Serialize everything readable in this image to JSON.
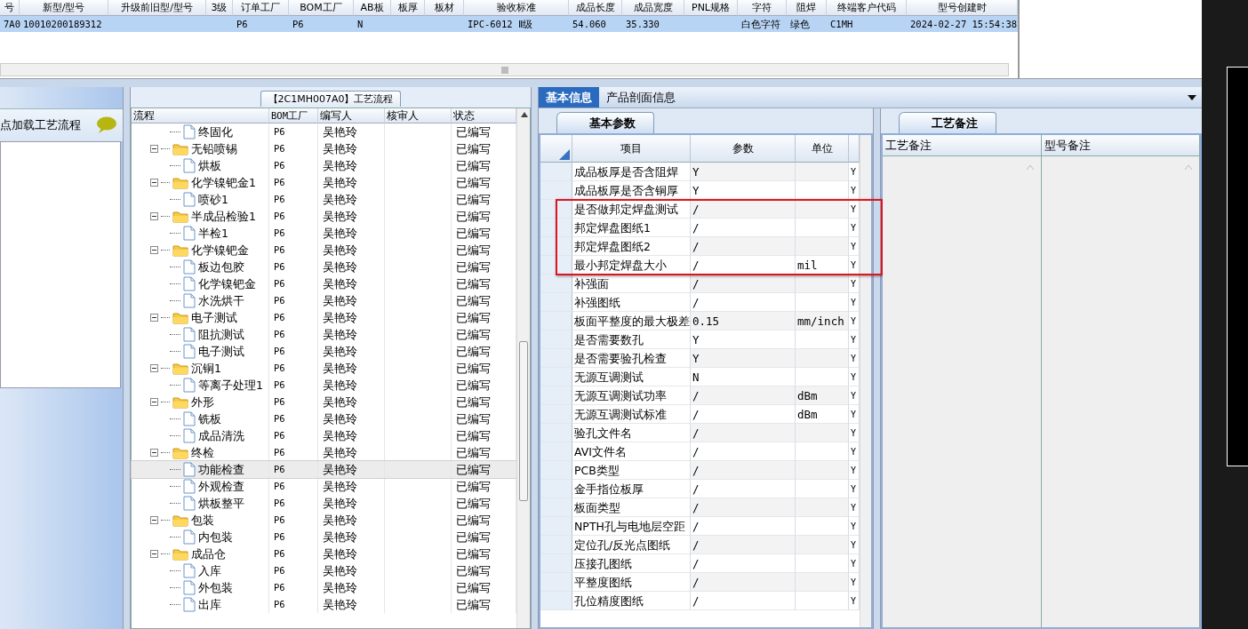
{
  "order_table": {
    "columns": [
      "号",
      "新型/型号",
      "升级前旧型/型号",
      "3级",
      "订单工厂",
      "BOM工厂",
      "AB板",
      "板厚",
      "板材",
      "验收标准",
      "成品长度",
      "成品宽度",
      "PNL规格",
      "字符",
      "阻焊",
      "终端客户代码",
      "型号创建时"
    ],
    "rows": [
      {
        "selected": true,
        "cells": [
          "7A0",
          "10010200189312",
          null,
          null,
          "P6",
          "P6",
          "N",
          null,
          null,
          "IPC-6012 Ⅱ级",
          "54.060",
          "35.330",
          null,
          "白色字符",
          "绿色",
          "C1MH",
          "2024-02-27 15:54:38"
        ]
      }
    ]
  },
  "left_panel": {
    "hint": "点加载工艺流程"
  },
  "process_tree": {
    "title": "【2C1MH007A0】工艺流程",
    "columns": [
      "流程",
      "BOM工厂",
      "编写人",
      "核审人",
      "状态"
    ],
    "items": [
      {
        "label": "终固化",
        "kind": "file",
        "selected": false,
        "bom": "P6",
        "author": "吴艳玲",
        "status": "已编写"
      },
      {
        "label": "无铅喷锡",
        "kind": "folder",
        "expanded": true,
        "selected": false,
        "bom": "P6",
        "author": "吴艳玲",
        "status": "已编写",
        "children": [
          {
            "label": "烘板",
            "kind": "file",
            "selected": false,
            "bom": "P6",
            "author": "吴艳玲",
            "status": "已编写"
          }
        ]
      },
      {
        "label": "化学镍钯金1",
        "kind": "folder",
        "expanded": true,
        "selected": false,
        "bom": "P6",
        "author": "吴艳玲",
        "status": "已编写",
        "children": [
          {
            "label": "喷砂1",
            "kind": "file",
            "selected": false,
            "bom": "P6",
            "author": "吴艳玲",
            "status": "已编写"
          }
        ]
      },
      {
        "label": "半成品检验1",
        "kind": "folder",
        "expanded": true,
        "selected": false,
        "bom": "P6",
        "author": "吴艳玲",
        "status": "已编写",
        "children": [
          {
            "label": "半检1",
            "kind": "file",
            "selected": false,
            "bom": "P6",
            "author": "吴艳玲",
            "status": "已编写"
          }
        ]
      },
      {
        "label": "化学镍钯金",
        "kind": "folder",
        "expanded": true,
        "selected": false,
        "bom": "P6",
        "author": "吴艳玲",
        "status": "已编写",
        "children": [
          {
            "label": "板边包胶",
            "kind": "file",
            "selected": false,
            "bom": "P6",
            "author": "吴艳玲",
            "status": "已编写"
          },
          {
            "label": "化学镍钯金",
            "kind": "file",
            "selected": false,
            "bom": "P6",
            "author": "吴艳玲",
            "status": "已编写"
          },
          {
            "label": "水洗烘干",
            "kind": "file",
            "selected": false,
            "bom": "P6",
            "author": "吴艳玲",
            "status": "已编写"
          }
        ]
      },
      {
        "label": "电子测试",
        "kind": "folder",
        "expanded": true,
        "selected": false,
        "bom": "P6",
        "author": "吴艳玲",
        "status": "已编写",
        "children": [
          {
            "label": "阻抗测试",
            "kind": "file",
            "selected": false,
            "bom": "P6",
            "author": "吴艳玲",
            "status": "已编写"
          },
          {
            "label": "电子测试",
            "kind": "file",
            "selected": false,
            "bom": "P6",
            "author": "吴艳玲",
            "status": "已编写"
          }
        ]
      },
      {
        "label": "沉铜1",
        "kind": "folder",
        "expanded": true,
        "selected": false,
        "bom": "P6",
        "author": "吴艳玲",
        "status": "已编写",
        "children": [
          {
            "label": "等离子处理1",
            "kind": "file",
            "selected": false,
            "bom": "P6",
            "author": "吴艳玲",
            "status": "已编写"
          }
        ]
      },
      {
        "label": "外形",
        "kind": "folder",
        "expanded": true,
        "selected": false,
        "bom": "P6",
        "author": "吴艳玲",
        "status": "已编写",
        "children": [
          {
            "label": "铣板",
            "kind": "file",
            "selected": false,
            "bom": "P6",
            "author": "吴艳玲",
            "status": "已编写"
          },
          {
            "label": "成品清洗",
            "kind": "file",
            "selected": false,
            "bom": "P6",
            "author": "吴艳玲",
            "status": "已编写"
          }
        ]
      },
      {
        "label": "终检",
        "kind": "folder",
        "expanded": true,
        "selected": false,
        "bom": "P6",
        "author": "吴艳玲",
        "status": "已编写",
        "children": [
          {
            "label": "功能检查",
            "kind": "file",
            "selected": true,
            "bom": "P6",
            "author": "吴艳玲",
            "status": "已编写"
          },
          {
            "label": "外观检查",
            "kind": "file",
            "selected": false,
            "bom": "P6",
            "author": "吴艳玲",
            "status": "已编写"
          },
          {
            "label": "烘板整平",
            "kind": "file",
            "selected": false,
            "bom": "P6",
            "author": "吴艳玲",
            "status": "已编写"
          }
        ]
      },
      {
        "label": "包装",
        "kind": "folder",
        "expanded": true,
        "selected": false,
        "bom": "P6",
        "author": "吴艳玲",
        "status": "已编写",
        "children": [
          {
            "label": "内包装",
            "kind": "file",
            "selected": false,
            "bom": "P6",
            "author": "吴艳玲",
            "status": "已编写"
          }
        ]
      },
      {
        "label": "成品仓",
        "kind": "folder",
        "expanded": true,
        "selected": false,
        "bom": "P6",
        "author": "吴艳玲",
        "status": "已编写",
        "children": [
          {
            "label": "入库",
            "kind": "file",
            "selected": false,
            "bom": "P6",
            "author": "吴艳玲",
            "status": "已编写"
          },
          {
            "label": "外包装",
            "kind": "file",
            "selected": false,
            "bom": "P6",
            "author": "吴艳玲",
            "status": "已编写"
          },
          {
            "label": "出库",
            "kind": "file",
            "selected": false,
            "bom": "P6",
            "author": "吴艳玲",
            "status": "已编写"
          }
        ]
      }
    ]
  },
  "info_tabs": [
    {
      "label": "基本信息",
      "selected": true
    },
    {
      "label": "产品剖面信息",
      "selected": false
    }
  ],
  "params": {
    "tab": {
      "label": "基本参数",
      "selected": true
    },
    "columns": [
      "项目",
      "参数",
      "单位"
    ],
    "rows": [
      {
        "item": "成品板厚是否含阻焊",
        "value": "Y",
        "flag": "Y",
        "highlighted": false
      },
      {
        "item": "成品板厚是否含铜厚",
        "value": "Y",
        "flag": "Y",
        "highlighted": false
      },
      {
        "item": "是否做邦定焊盘测试",
        "value": "/",
        "flag": "Y",
        "highlighted": true
      },
      {
        "item": "邦定焊盘图纸1",
        "value": "/",
        "flag": "Y",
        "highlighted": true
      },
      {
        "item": "邦定焊盘图纸2",
        "value": "/",
        "flag": "Y",
        "highlighted": true
      },
      {
        "item": "最小邦定焊盘大小",
        "value": "/",
        "unit": "mil",
        "flag": "Y",
        "highlighted": true
      },
      {
        "item": "补强面",
        "value": "/",
        "flag": "Y",
        "highlighted": false
      },
      {
        "item": "补强图纸",
        "value": "/",
        "flag": "Y",
        "highlighted": false
      },
      {
        "item": "板面平整度的最大极差",
        "value": "0.15",
        "unit": "mm/inch",
        "flag": "Y",
        "highlighted": false
      },
      {
        "item": "是否需要数孔",
        "value": "Y",
        "flag": "Y",
        "highlighted": false
      },
      {
        "item": "是否需要验孔检查",
        "value": "Y",
        "flag": "Y",
        "highlighted": false
      },
      {
        "item": "无源互调测试",
        "value": "N",
        "flag": "Y",
        "highlighted": false
      },
      {
        "item": "无源互调测试功率",
        "value": "/",
        "unit": "dBm",
        "flag": "Y",
        "highlighted": false
      },
      {
        "item": "无源互调测试标准",
        "value": "/",
        "unit": "dBm",
        "flag": "Y",
        "highlighted": false
      },
      {
        "item": "验孔文件名",
        "value": "/",
        "flag": "Y",
        "highlighted": false
      },
      {
        "item": "AVI文件名",
        "value": "/",
        "flag": "Y",
        "highlighted": false
      },
      {
        "item": "PCB类型",
        "value": "/",
        "flag": "Y",
        "highlighted": false
      },
      {
        "item": "金手指位板厚",
        "value": "/",
        "flag": "Y",
        "highlighted": false
      },
      {
        "item": "板面类型",
        "value": "/",
        "flag": "Y",
        "highlighted": false
      },
      {
        "item": "NPTH孔与电地层空距",
        "value": "/",
        "flag": "Y",
        "highlighted": false
      },
      {
        "item": "定位孔/反光点图纸",
        "value": "/",
        "flag": "Y",
        "highlighted": false
      },
      {
        "item": "压接孔图纸",
        "value": "/",
        "flag": "Y",
        "highlighted": false
      },
      {
        "item": "平整度图纸",
        "value": "/",
        "flag": "Y",
        "highlighted": false
      },
      {
        "item": "孔位精度图纸",
        "value": "/",
        "flag": "Y",
        "highlighted": false
      }
    ]
  },
  "remarks": {
    "tab": {
      "label": "工艺备注",
      "selected": true
    },
    "columns": [
      "工艺备注",
      "型号备注"
    ]
  }
}
